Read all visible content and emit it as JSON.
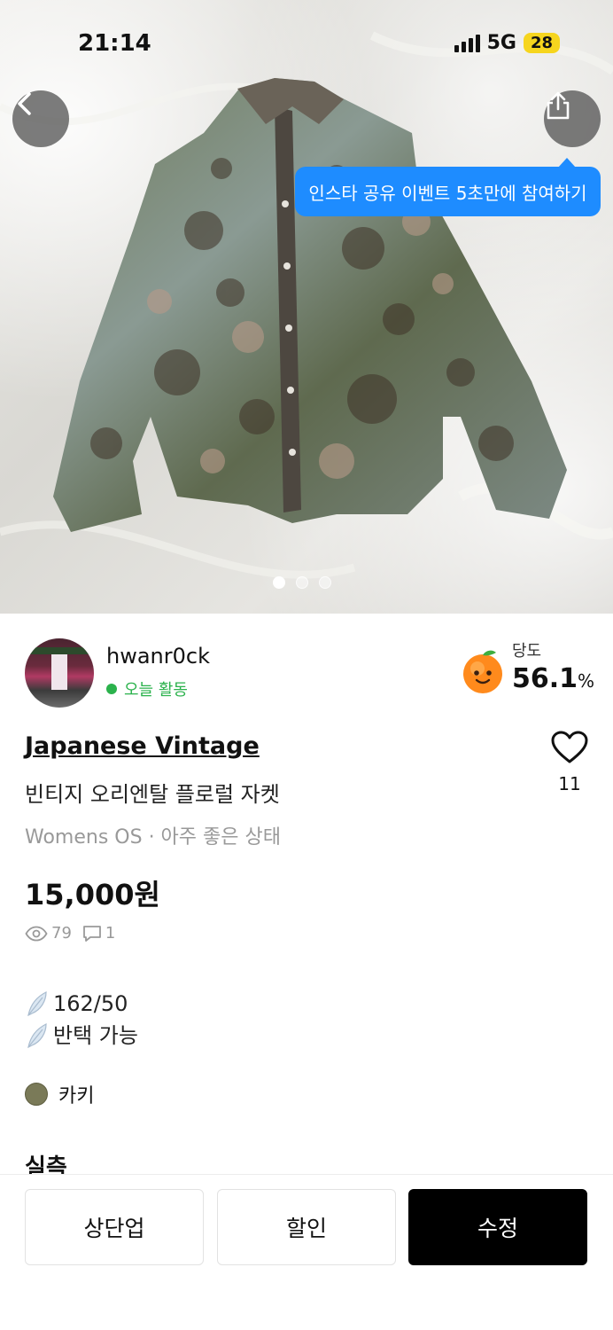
{
  "status_bar": {
    "time": "21:14",
    "network": "5G",
    "battery": "28"
  },
  "hero": {
    "tooltip": "인스타 공유 이벤트 5초만에 참여하기",
    "page_dots": 3,
    "active_dot": 1
  },
  "seller": {
    "name": "hwanr0ck",
    "activity": "오늘 활동",
    "sweetness_label": "당도",
    "sweetness_value": "56.1",
    "sweetness_unit": "%"
  },
  "product": {
    "brand": "Japanese Vintage",
    "title": "빈티지 오리엔탈 플로럴 자켓",
    "meta": "Womens OS · 아주 좋은 상태",
    "price": "15,000원",
    "likes": "11",
    "views": "79",
    "chats": "1"
  },
  "description": {
    "lines": [
      "162/50",
      "반택 가능"
    ],
    "color_name": "카키",
    "color_hex": "#7a7a58",
    "next_section": "실측"
  },
  "actions": {
    "bump": "상단업",
    "discount": "할인",
    "edit": "수정"
  },
  "colors": {
    "accent_blue": "#1e8cff",
    "active_green": "#2bb24c",
    "primary_black": "#000000"
  }
}
